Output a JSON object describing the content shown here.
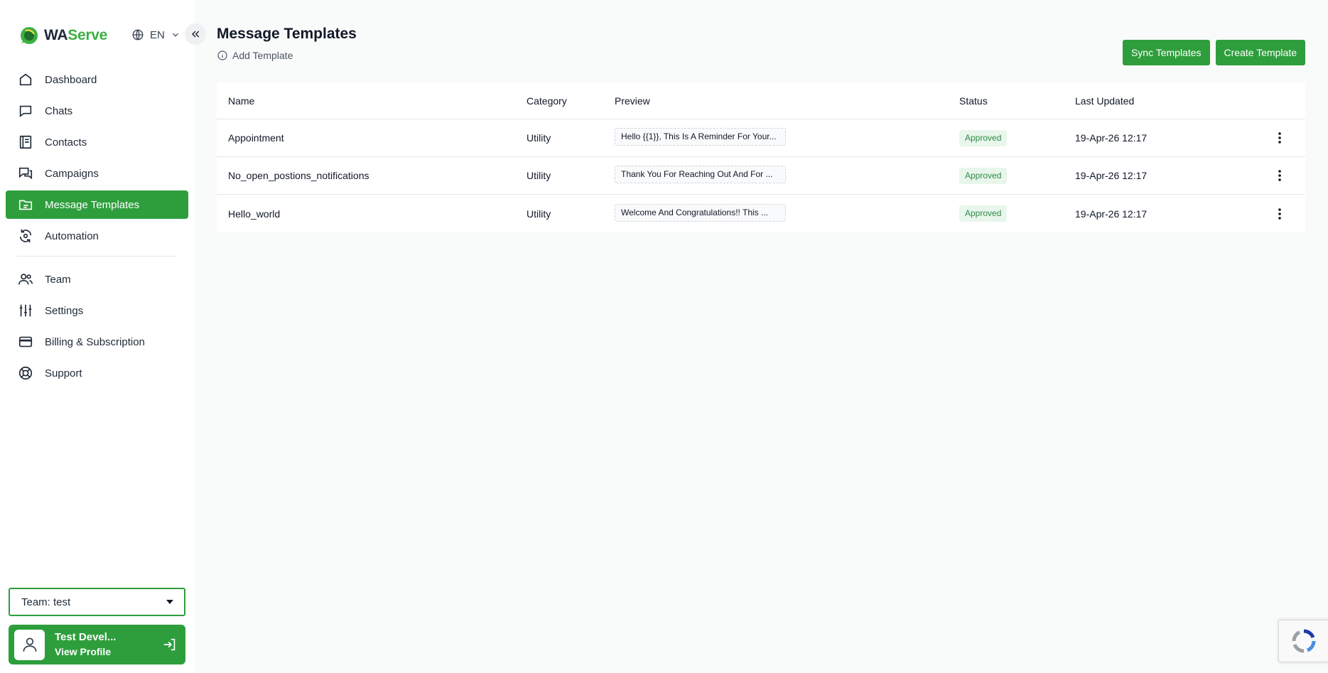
{
  "brand": {
    "name_part1": "WA",
    "name_part2": "Serve"
  },
  "language": {
    "label": "EN"
  },
  "nav": {
    "items": [
      {
        "label": "Dashboard",
        "icon": "home-icon"
      },
      {
        "label": "Chats",
        "icon": "chat-icon"
      },
      {
        "label": "Contacts",
        "icon": "contacts-icon"
      },
      {
        "label": "Campaigns",
        "icon": "campaigns-icon"
      },
      {
        "label": "Message Templates",
        "icon": "template-icon",
        "active": true
      },
      {
        "label": "Automation",
        "icon": "automation-icon"
      },
      {
        "label": "Team",
        "icon": "team-icon"
      },
      {
        "label": "Settings",
        "icon": "settings-sliders-icon"
      },
      {
        "label": "Billing & Subscription",
        "icon": "credit-card-icon"
      },
      {
        "label": "Support",
        "icon": "lifebuoy-icon"
      }
    ]
  },
  "team_select": {
    "label": "Team: test"
  },
  "profile": {
    "name": "Test Devel...",
    "link": "View Profile"
  },
  "page": {
    "title": "Message Templates",
    "add_template": "Add Template"
  },
  "actions": {
    "sync": "Sync Templates",
    "create": "Create Template"
  },
  "table": {
    "headers": {
      "name": "Name",
      "category": "Category",
      "preview": "Preview",
      "status": "Status",
      "last_updated": "Last Updated"
    },
    "rows": [
      {
        "name": "Appointment",
        "category": "Utility",
        "preview": "Hello {{1}}, This Is A Reminder For Your...",
        "status": "Approved",
        "last_updated": "19-Apr-26 12:17"
      },
      {
        "name": "No_open_postions_notifications",
        "category": "Utility",
        "preview": "Thank You For Reaching Out And For ...",
        "status": "Approved",
        "last_updated": "19-Apr-26 12:17"
      },
      {
        "name": "Hello_world",
        "category": "Utility",
        "preview": "Welcome And Congratulations!! This ...",
        "status": "Approved",
        "last_updated": "19-Apr-26 12:17"
      }
    ]
  },
  "colors": {
    "accent": "#2e9e3c",
    "brand_green": "#3cb043",
    "approved_bg": "#e8f6ec",
    "approved_text": "#2e8b45"
  }
}
